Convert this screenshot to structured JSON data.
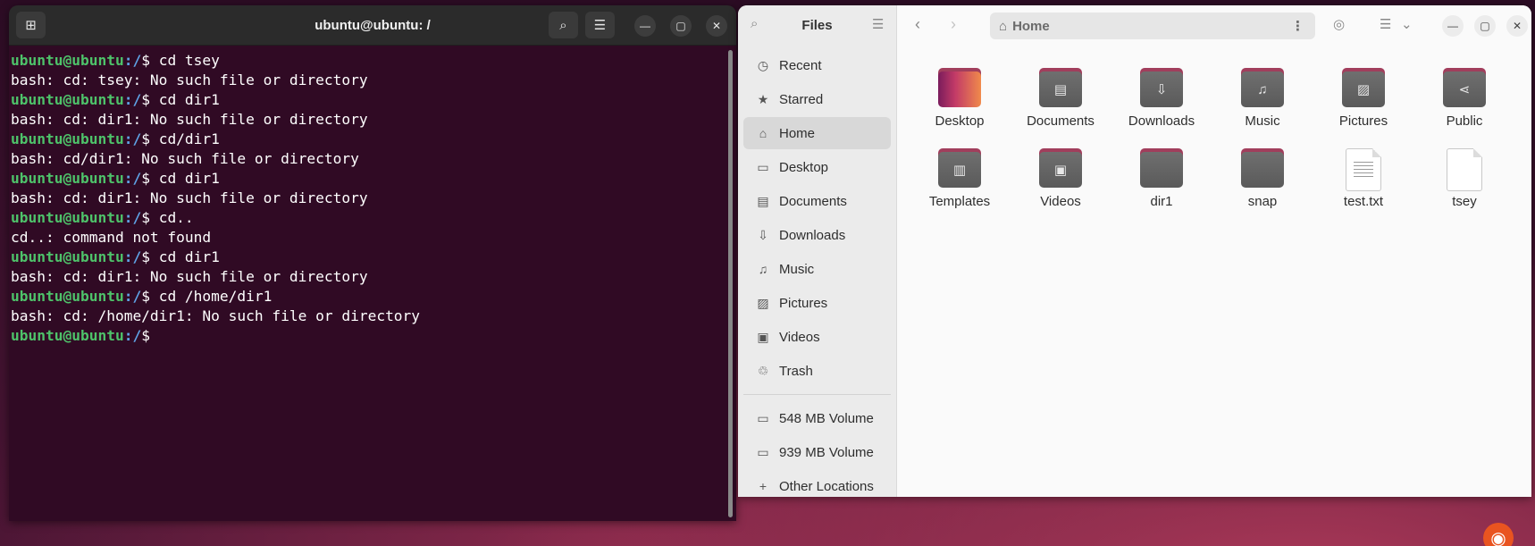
{
  "terminal": {
    "title": "ubuntu@ubuntu: /",
    "prompt_user": "ubuntu@ubuntu",
    "prompt_path": ":/",
    "lines": [
      {
        "type": "cmd",
        "text": "$ cd tsey"
      },
      {
        "type": "out",
        "text": "bash: cd: tsey: No such file or directory"
      },
      {
        "type": "cmd",
        "text": "$ cd dir1"
      },
      {
        "type": "out",
        "text": "bash: cd: dir1: No such file or directory"
      },
      {
        "type": "cmd",
        "text": "$ cd/dir1"
      },
      {
        "type": "out",
        "text": "bash: cd/dir1: No such file or directory"
      },
      {
        "type": "cmd",
        "text": "$ cd dir1"
      },
      {
        "type": "out",
        "text": "bash: cd: dir1: No such file or directory"
      },
      {
        "type": "cmd",
        "text": "$ cd.."
      },
      {
        "type": "out",
        "text": "cd..: command not found"
      },
      {
        "type": "cmd",
        "text": "$ cd dir1"
      },
      {
        "type": "out",
        "text": "bash: cd: dir1: No such file or directory"
      },
      {
        "type": "cmd",
        "text": "$ cd /home/dir1"
      },
      {
        "type": "out",
        "text": "bash: cd: /home/dir1: No such file or directory"
      },
      {
        "type": "cmd",
        "text": "$ "
      }
    ]
  },
  "files": {
    "title": "Files",
    "location": "Home",
    "sidebar": [
      {
        "label": "Recent",
        "icon": "clock-icon",
        "glyph": "◷"
      },
      {
        "label": "Starred",
        "icon": "star-icon",
        "glyph": "★"
      },
      {
        "label": "Home",
        "icon": "home-icon",
        "glyph": "⌂",
        "active": true
      },
      {
        "label": "Desktop",
        "icon": "desktop-icon",
        "glyph": "▭"
      },
      {
        "label": "Documents",
        "icon": "document-icon",
        "glyph": "▤"
      },
      {
        "label": "Downloads",
        "icon": "download-icon",
        "glyph": "⇩"
      },
      {
        "label": "Music",
        "icon": "music-icon",
        "glyph": "♫"
      },
      {
        "label": "Pictures",
        "icon": "picture-icon",
        "glyph": "▨"
      },
      {
        "label": "Videos",
        "icon": "video-icon",
        "glyph": "▣"
      },
      {
        "label": "Trash",
        "icon": "trash-icon",
        "glyph": "♲"
      }
    ],
    "volumes": [
      {
        "label": "548 MB Volume",
        "icon": "drive-icon",
        "glyph": "▭"
      },
      {
        "label": "939 MB Volume",
        "icon": "drive-icon",
        "glyph": "▭"
      }
    ],
    "other_locations": "Other Locations",
    "items": [
      {
        "label": "Desktop",
        "kind": "folder-desktop",
        "glyph": ""
      },
      {
        "label": "Documents",
        "kind": "folder",
        "glyph": "▤"
      },
      {
        "label": "Downloads",
        "kind": "folder",
        "glyph": "⇩"
      },
      {
        "label": "Music",
        "kind": "folder",
        "glyph": "♫"
      },
      {
        "label": "Pictures",
        "kind": "folder",
        "glyph": "▨"
      },
      {
        "label": "Public",
        "kind": "folder",
        "glyph": "⋖"
      },
      {
        "label": "Templates",
        "kind": "folder",
        "glyph": "▥"
      },
      {
        "label": "Videos",
        "kind": "folder",
        "glyph": "▣"
      },
      {
        "label": "dir1",
        "kind": "folder",
        "glyph": ""
      },
      {
        "label": "snap",
        "kind": "folder",
        "glyph": ""
      },
      {
        "label": "test.txt",
        "kind": "text-file",
        "glyph": ""
      },
      {
        "label": "tsey",
        "kind": "blank-file",
        "glyph": ""
      }
    ]
  }
}
